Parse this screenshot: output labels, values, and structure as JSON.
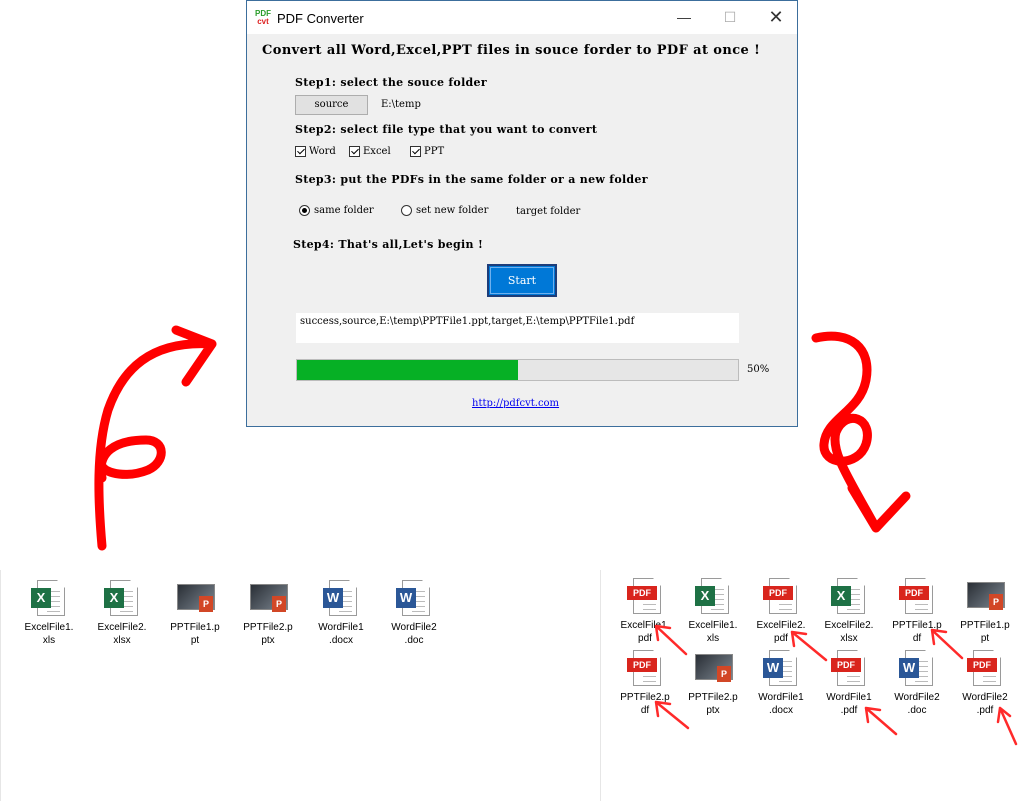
{
  "window": {
    "logo_top": "PDF",
    "logo_bottom": "cvt",
    "title": "PDF Converter",
    "minimize": "—",
    "maximize": "☐",
    "close": "✕"
  },
  "headline": "Convert all Word,Excel,PPT files in souce forder to PDF at once !",
  "step1": {
    "label": "Step1: select the souce folder",
    "button": "source",
    "path": "E:\\temp"
  },
  "step2": {
    "label": "Step2: select file type that you want to convert",
    "options": [
      {
        "label": "Word",
        "checked": true
      },
      {
        "label": "Excel",
        "checked": true
      },
      {
        "label": "PPT",
        "checked": true
      }
    ]
  },
  "step3": {
    "label": "Step3: put the PDFs in the same folder or a new folder",
    "same_folder": "same folder",
    "new_folder": "set new folder",
    "target": "target folder",
    "selected": "same folder"
  },
  "step4": {
    "label": "Step4: That's all,Let's begin !",
    "button": "Start"
  },
  "log": "success,source,E:\\temp\\PPTFile1.ppt,target,E:\\temp\\PPTFile1.pdf",
  "progress": {
    "percent": 50,
    "text": "50%"
  },
  "link": "http://pdfcvt.com",
  "colors": {
    "progress": "#06b025",
    "start_button": "#0078d7",
    "arrow": "#ff0000",
    "pdf": "#d9251d"
  },
  "source_files": [
    {
      "name": "ExcelFile1.\nxls",
      "type": "excel"
    },
    {
      "name": "ExcelFile2.\nxlsx",
      "type": "excel"
    },
    {
      "name": "PPTFile1.p\npt",
      "type": "ppt"
    },
    {
      "name": "PPTFile2.p\nptx",
      "type": "ppt"
    },
    {
      "name": "WordFile1\n.docx",
      "type": "word"
    },
    {
      "name": "WordFile2\n.doc",
      "type": "word"
    }
  ],
  "result_files": [
    {
      "name": "ExcelFile1.\npdf",
      "type": "pdf"
    },
    {
      "name": "ExcelFile1.\nxls",
      "type": "excel"
    },
    {
      "name": "ExcelFile2.\npdf",
      "type": "pdf"
    },
    {
      "name": "ExcelFile2.\nxlsx",
      "type": "excel"
    },
    {
      "name": "PPTFile1.p\ndf",
      "type": "pdf"
    },
    {
      "name": "PPTFile1.p\npt",
      "type": "ppt"
    },
    {
      "name": "PPTFile2.p\ndf",
      "type": "pdf"
    },
    {
      "name": "PPTFile2.p\nptx",
      "type": "ppt"
    },
    {
      "name": "WordFile1\n.docx",
      "type": "word"
    },
    {
      "name": "WordFile1\n.pdf",
      "type": "pdf"
    },
    {
      "name": "WordFile2\n.doc",
      "type": "word"
    },
    {
      "name": "WordFile2\n.pdf",
      "type": "pdf"
    }
  ]
}
